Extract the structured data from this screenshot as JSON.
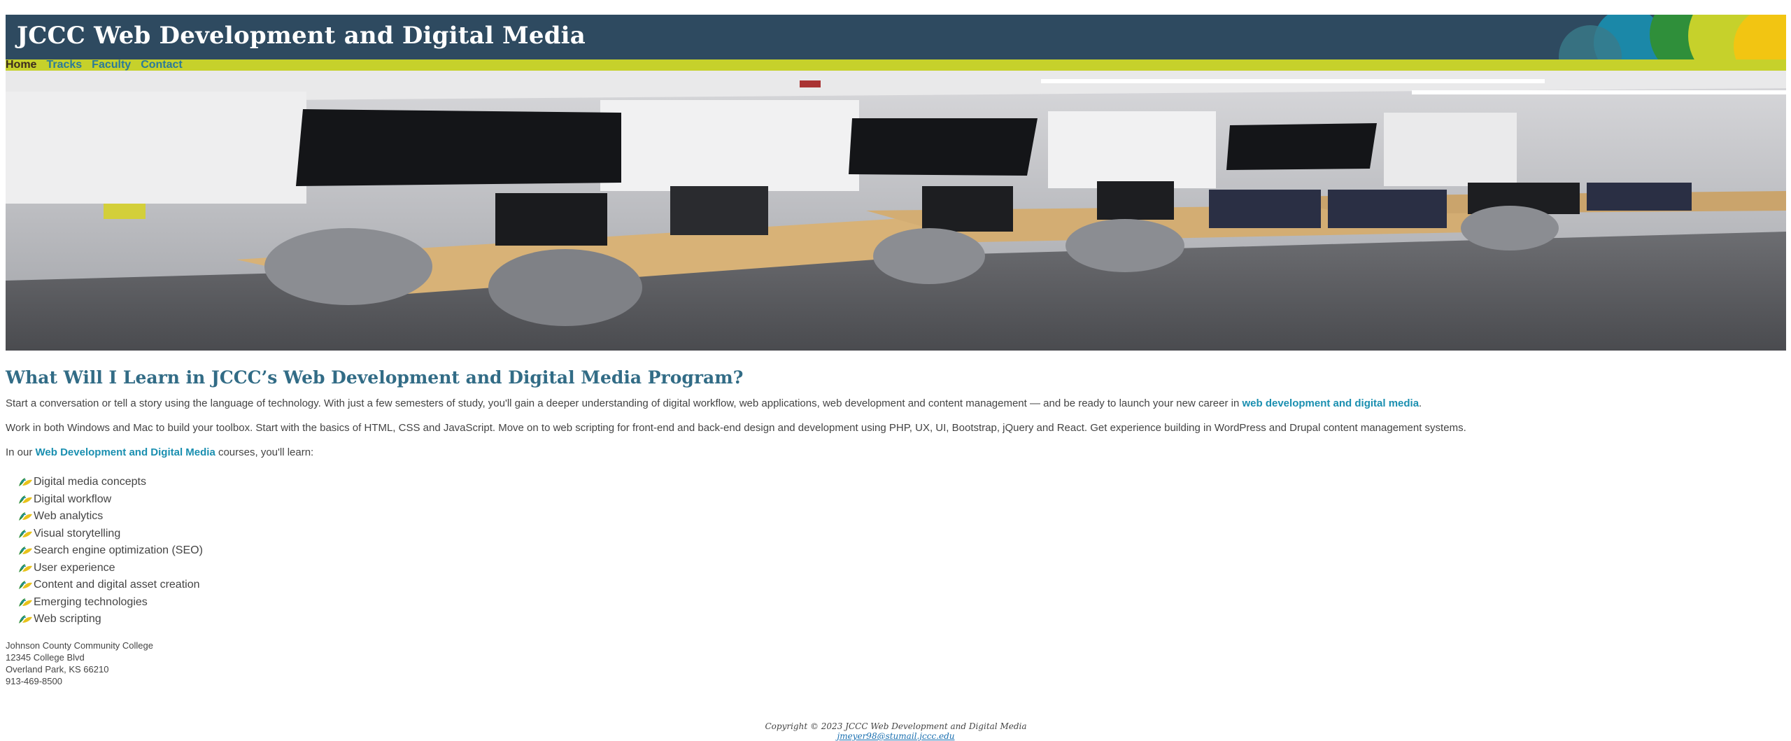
{
  "site": {
    "title": "JCCC Web Development and Digital Media"
  },
  "nav": {
    "items": [
      {
        "label": "Home",
        "current": true
      },
      {
        "label": "Tracks",
        "current": false
      },
      {
        "label": "Faculty",
        "current": false
      },
      {
        "label": "Contact",
        "current": false
      }
    ]
  },
  "hero": {
    "alt": "Computer lab classroom with desks, monitors and chairs"
  },
  "main": {
    "heading": "What Will I Learn in JCCC’s Web Development and Digital Media Program?",
    "p1_text": "Start a conversation or tell a story using the language of technology. With just a few semesters of study, you'll gain a deeper understanding of digital workflow, web applications, web development and content management — and be ready to launch your new career in ",
    "p1_link": "web development and digital media",
    "p1_end": ".",
    "p2": "Work in both Windows and Mac to build your toolbox. Start with the basics of HTML, CSS and JavaScript. Move on to web scripting for front-end and back-end design and development using PHP, UX, UI, Bootstrap, jQuery and React. Get experience building in WordPress and Drupal content management systems.",
    "p3_start": "In our ",
    "p3_link": "Web Development and Digital Media",
    "p3_end": " courses, you'll learn:",
    "learn_items": [
      "Digital media concepts",
      "Digital workflow",
      "Web analytics",
      "Visual storytelling",
      "Search engine optimization (SEO)",
      "User experience",
      "Content and digital asset creation",
      "Emerging technologies",
      "Web scripting"
    ]
  },
  "address": {
    "line1": "Johnson County Community College",
    "line2": "12345 College Blvd",
    "line3": "Overland Park, KS 66210",
    "line4": "913-469-8500"
  },
  "footer": {
    "copyright": "Copyright © 2023 JCCC Web Development and Digital Media",
    "email": "jmeyer98@stumail.jccc.edu"
  },
  "colors": {
    "header_bg": "#2e4a60",
    "nav_bg": "#c6d12b",
    "heading": "#326c86",
    "link": "#1a8fb0"
  },
  "icons": {
    "list_bullet": "leaf-bullet-icon"
  }
}
